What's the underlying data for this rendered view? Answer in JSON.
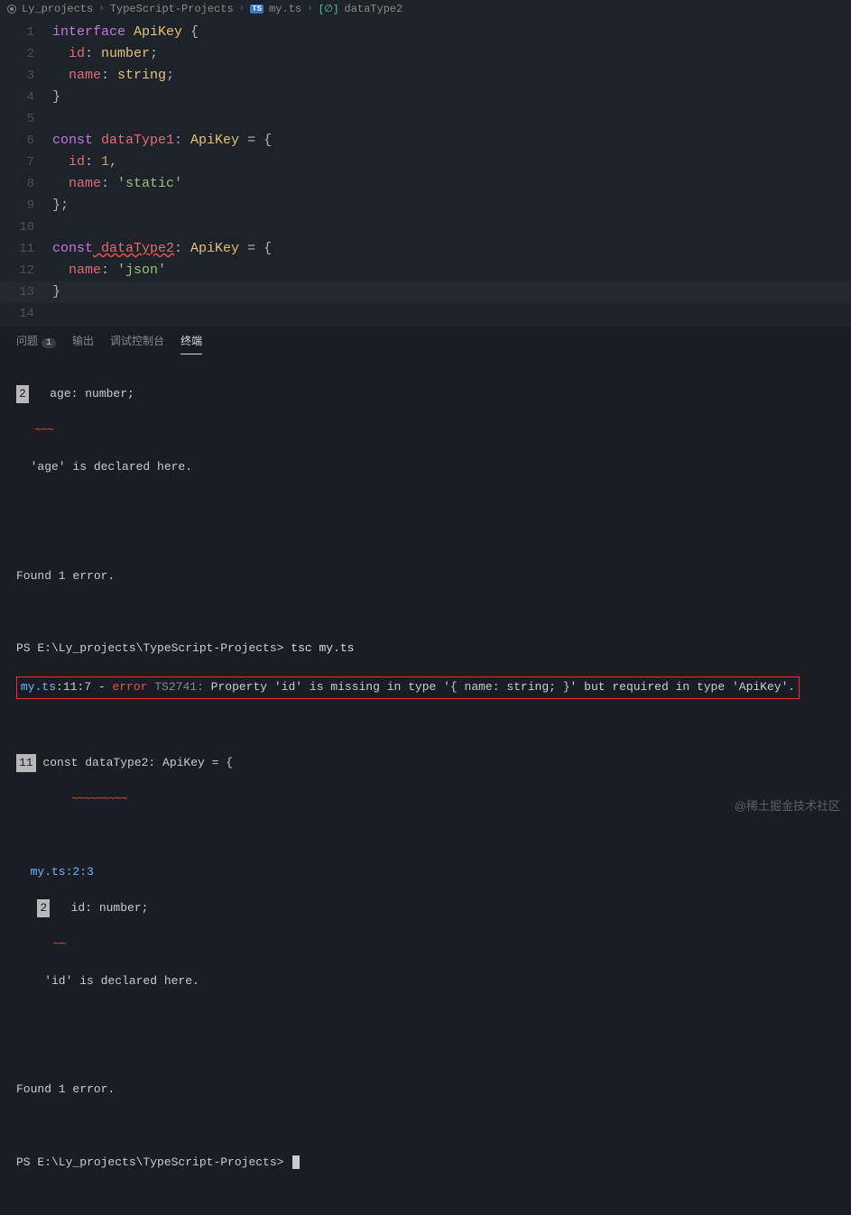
{
  "breadcrumbs": {
    "seg1": "Ly_projects",
    "seg2": "TypeScript-Projects",
    "seg3": "my.ts",
    "seg4": "dataType2",
    "tsBadge": "TS",
    "symBadge": "[∅]"
  },
  "code": {
    "l1_kw": "interface",
    "l1_type": " ApiKey ",
    "l1_brace": "{",
    "l2_prop": "id",
    "l2_col": ": ",
    "l2_t": "number",
    "l2_semi": ";",
    "l3_prop": "name",
    "l3_col": ": ",
    "l3_t": "string",
    "l3_semi": ";",
    "l4": "}",
    "l6_kw": "const",
    "l6_var": " dataType1",
    "l6_col": ": ",
    "l6_type": "ApiKey",
    "l6_eq": " = {",
    "l7_prop": "id",
    "l7_col": ": ",
    "l7_val": "1",
    "l7_c": ",",
    "l8_prop": "name",
    "l8_col": ": ",
    "l8_val": "'static'",
    "l9": "};",
    "l11_kw": "const",
    "l11_var": " dataType2",
    "l11_col": ": ",
    "l11_type": "ApiKey",
    "l11_eq": " = {",
    "l12_prop": "name",
    "l12_col": ": ",
    "l12_val": "'json'",
    "l13": "}",
    "lines": [
      "1",
      "2",
      "3",
      "4",
      "5",
      "6",
      "7",
      "8",
      "9",
      "10",
      "11",
      "12",
      "13",
      "14"
    ]
  },
  "panel": {
    "tabs": {
      "t1": "问题",
      "t1badge": "1",
      "t2": "输出",
      "t3": "调试控制台",
      "t4": "终端"
    }
  },
  "terminal": {
    "snip1_ln": "2",
    "snip1_code": "   age: number;",
    "snip1_wavy": "   ~~~",
    "snip1_decl": "  'age' is declared here.",
    "found1": "Found 1 error.",
    "prompt1_pre": "PS ",
    "prompt1_path": "E:\\Ly_projects\\TypeScript-Projects> ",
    "prompt1_cmd": "tsc my.ts",
    "err_loc_file": "my.ts",
    "err_loc_pos": ":11:7 - ",
    "err_word": "error",
    "err_code": " TS2741: ",
    "err_msg": "Property 'id' is missing in type '{ name: string; }' but required in type 'ApiKey'.",
    "ctx_ln": "11",
    "ctx_code": " const dataType2: ApiKey = {",
    "ctx_wavy": "         ~~~~~~~~~",
    "ref_loc": "  my.ts:2:3",
    "ref_ln": "2",
    "ref_code": "   id: number;",
    "ref_wavy": "   ~~",
    "ref_decl": "    'id' is declared here.",
    "found2": "Found 1 error.",
    "prompt2_pre": "PS ",
    "prompt2_path": "E:\\Ly_projects\\TypeScript-Projects> "
  },
  "watermark": "@稀土掘金技术社区"
}
